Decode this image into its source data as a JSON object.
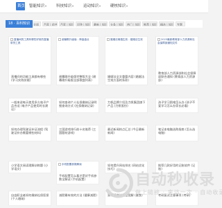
{
  "nav": {
    "items": [
      {
        "label": "首页",
        "active": true
      },
      {
        "label": "智能知识",
        "chevron": "▾"
      },
      {
        "label": "科技知识",
        "chevron": "▾"
      },
      {
        "label": "运动知识",
        "chevron": "▾"
      },
      {
        "label": "硬核知识",
        "chevron": "▾"
      }
    ]
  },
  "breadcrumb": {
    "label": "18 · 百科知识"
  },
  "tag_chips": [
    "全部",
    "百家 | 综合",
    "百家 | 知识",
    "问答 | 知识",
    "最新 | 知识",
    "头条 | 知识",
    "热门 | 知识",
    "推荐 | 知识",
    "精选 | 知识",
    "专题"
  ],
  "cards": [
    {
      "img_alt": "直播间的工具有哪些好用的直播带货工具",
      "title": "直播间的功能工具都有哪些 (学习实践技能)"
    },
    {
      "img_alt": "谢幕歌升级版 - 神曲盘点",
      "title": "谢幕歌升级版完整版大全 (谢幕歌升级版全部歌曲列表)"
    },
    {
      "img_alt": "婚姻法离婚生效 - 婚姻法生效",
      "title": "婚姻法全文重要内容 (婚姻法生效方面的条款)"
    },
    {
      "img_alt": "2023最新教育部人力资源和社会保障部通知文件",
      "title": "教育部人力资源部和社会保障部联合通知 (教育部人力资源部)"
    },
    {
      "title": "一般来说每天使用多久电子产品合适 (电子产品使用时长建议)"
    },
    {
      "title": "如何查询个人社保缴纳记录明细查询方式 (社保缴纳记录)"
    },
    {
      "title": "力帆品牌介绍及力帆集团旗下产品 (力帆股份)"
    },
    {
      "title": "孩子学习困难怎么办 (孩子不爱学习怎么办家长必看)"
    },
    {
      "title": "如何办理驾驶证补证流程 (驾驶证补办需要哪些材料)"
    },
    {
      "title": "三国游戏排行前十名推荐 (三国题材游戏)"
    },
    {
      "title": "最近新闻热点汇总 (今日最新新闻)"
    },
    {
      "title": "笔记本电脑选购指南 (怎么选电脑)"
    },
    {
      "title": "小学语文阅读理解训练题 (小学语文)"
    },
    {
      "img_alt": "手机配置参数解读",
      "title": "手机配置怎么看才是好手机参数全解读 (手机配置)"
    },
    {
      "title": "如何提升网站排名 (网站优化技巧)"
    },
    {
      "title": "推荐几款好用的记账软件 (记账)"
    },
    {
      "title": "自由职业者如何缴纳社保医保 (个人缴纳)"
    },
    {
      "img_alt": "减肥方法推荐",
      "title": "减肥最有效的方法 (健康减肥)"
    },
    {
      "title": "家常菜做法大全图解 (美食)"
    },
    {
      "title": "考研复试注意事项 (考研)"
    }
  ],
  "watermark": {
    "title": "自动秒收录",
    "subtitle": "做上链接 · 来访一次 · 自动收录"
  }
}
